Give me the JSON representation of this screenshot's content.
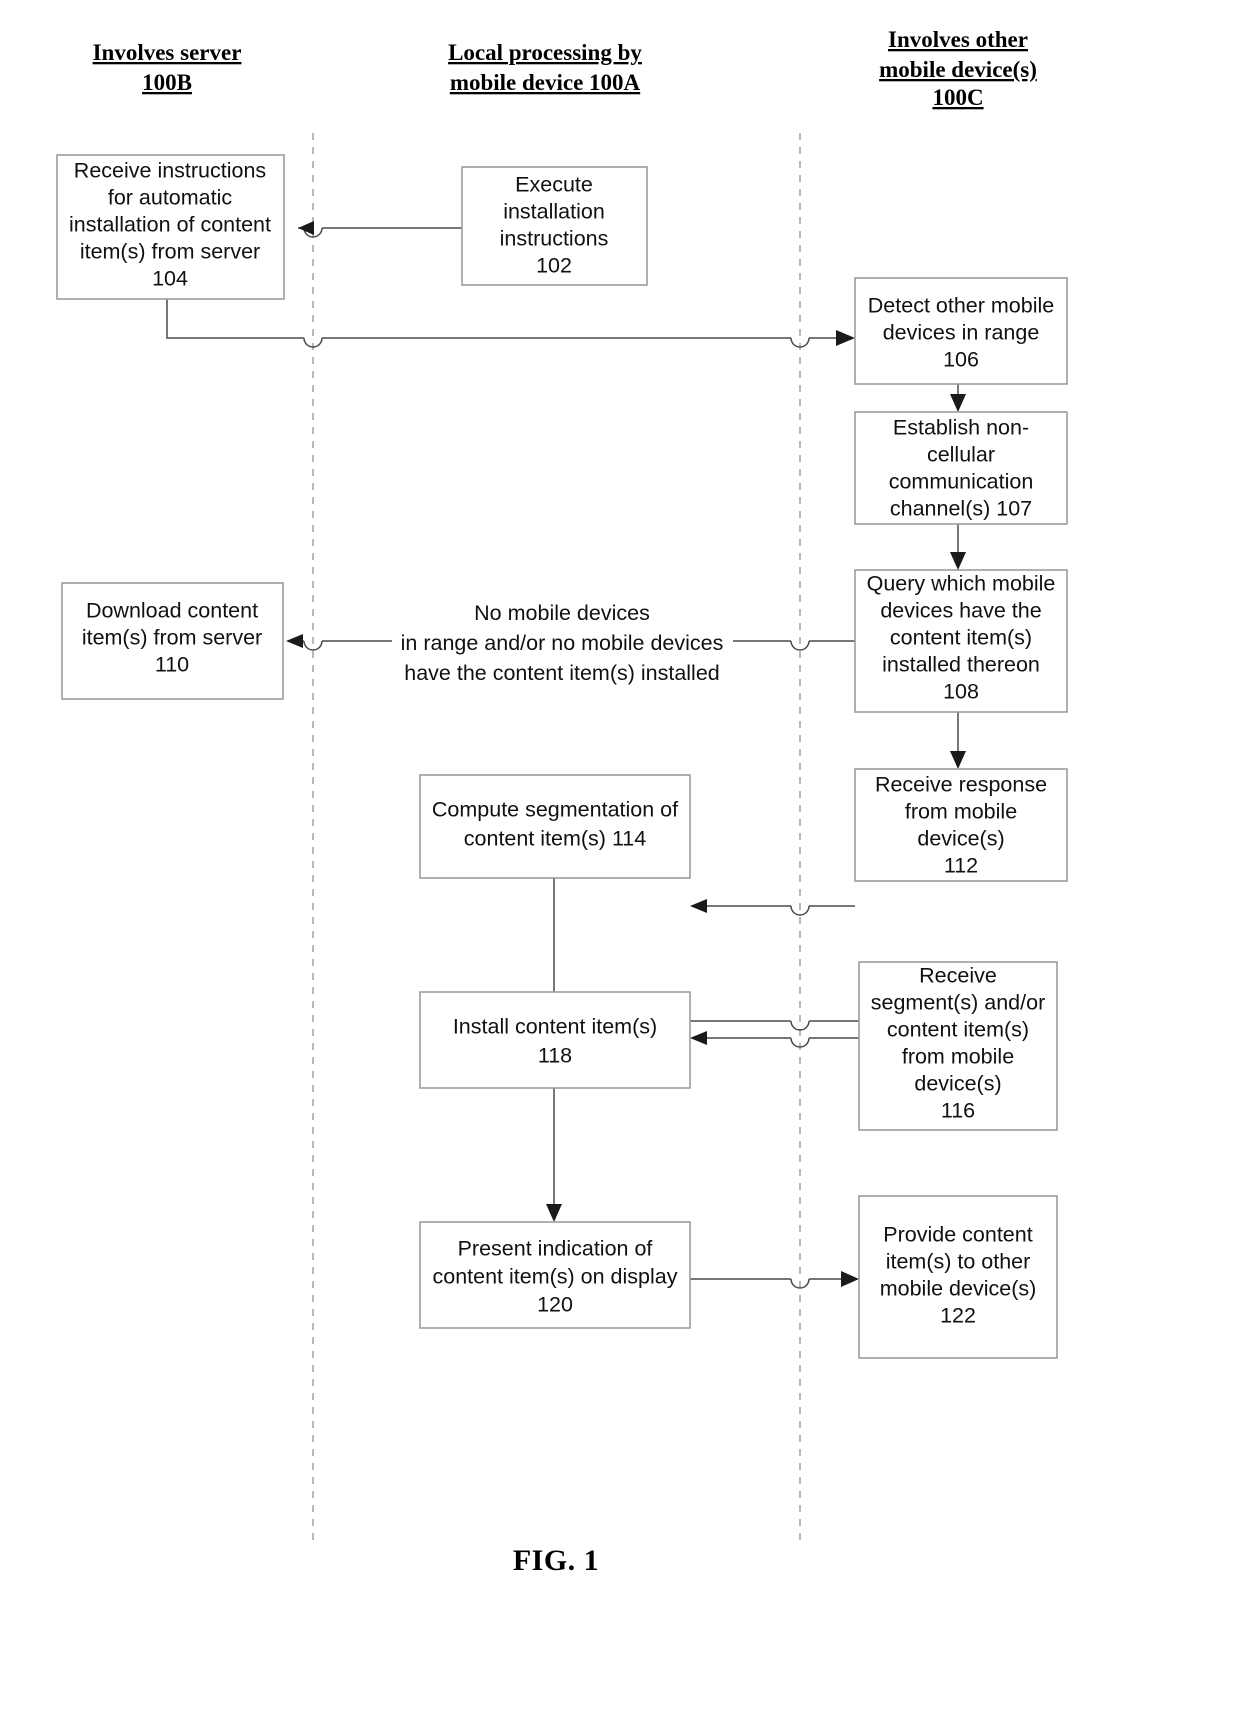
{
  "figure": {
    "caption": "FIG. 1"
  },
  "lanes": [
    {
      "id": "server",
      "line1": "Involves server",
      "line2": "100B",
      "line3": ""
    },
    {
      "id": "mobile-local",
      "line1": "Local processing by",
      "line2": "mobile device 100A",
      "line3": ""
    },
    {
      "id": "other-mobile",
      "line1": "Involves other",
      "line2": "mobile device(s)",
      "line3": "100C"
    }
  ],
  "nodes": [
    {
      "id": "node-104",
      "lane": "server",
      "ref": "104",
      "lines": [
        "Receive instructions",
        "for automatic",
        "installation of content",
        "item(s) from server",
        "104"
      ]
    },
    {
      "id": "node-102",
      "lane": "mobile-local",
      "ref": "102",
      "lines": [
        "Execute",
        "installation",
        "instructions",
        "102"
      ]
    },
    {
      "id": "node-106",
      "lane": "other-mobile",
      "ref": "106",
      "lines": [
        "Detect other mobile",
        "devices in range",
        "106"
      ]
    },
    {
      "id": "node-107",
      "lane": "other-mobile",
      "ref": "107",
      "lines": [
        "Establish non-",
        "cellular",
        "communication",
        "channel(s) 107"
      ]
    },
    {
      "id": "node-110",
      "lane": "server",
      "ref": "110",
      "lines": [
        "Download content",
        "item(s) from server",
        "110"
      ]
    },
    {
      "id": "node-108",
      "lane": "other-mobile",
      "ref": "108",
      "lines": [
        "Query which mobile",
        "devices have the",
        "content item(s)",
        "installed thereon",
        "108"
      ]
    },
    {
      "id": "node-114",
      "lane": "mobile-local",
      "ref": "114",
      "lines": [
        "Compute segmentation of",
        "content item(s) 114"
      ]
    },
    {
      "id": "node-112",
      "lane": "other-mobile",
      "ref": "112",
      "lines": [
        "Receive response",
        "from mobile",
        "device(s)",
        "112"
      ]
    },
    {
      "id": "node-118",
      "lane": "mobile-local",
      "ref": "118",
      "lines": [
        "Install content item(s)",
        "118"
      ]
    },
    {
      "id": "node-116",
      "lane": "other-mobile",
      "ref": "116",
      "lines": [
        "Receive",
        "segment(s) and/or",
        "content item(s)",
        "from mobile",
        "device(s)",
        "116"
      ]
    },
    {
      "id": "node-120",
      "lane": "mobile-local",
      "ref": "120",
      "lines": [
        "Present indication of",
        "content item(s) on display",
        "120"
      ]
    },
    {
      "id": "node-122",
      "lane": "other-mobile",
      "ref": "122",
      "lines": [
        "Provide content",
        "item(s) to other",
        "mobile device(s)",
        "122"
      ]
    }
  ],
  "edge_labels": [
    {
      "id": "no-devices-label",
      "lines": [
        "No mobile devices",
        "in range and/or no mobile devices",
        "have the content item(s) installed"
      ]
    }
  ]
}
